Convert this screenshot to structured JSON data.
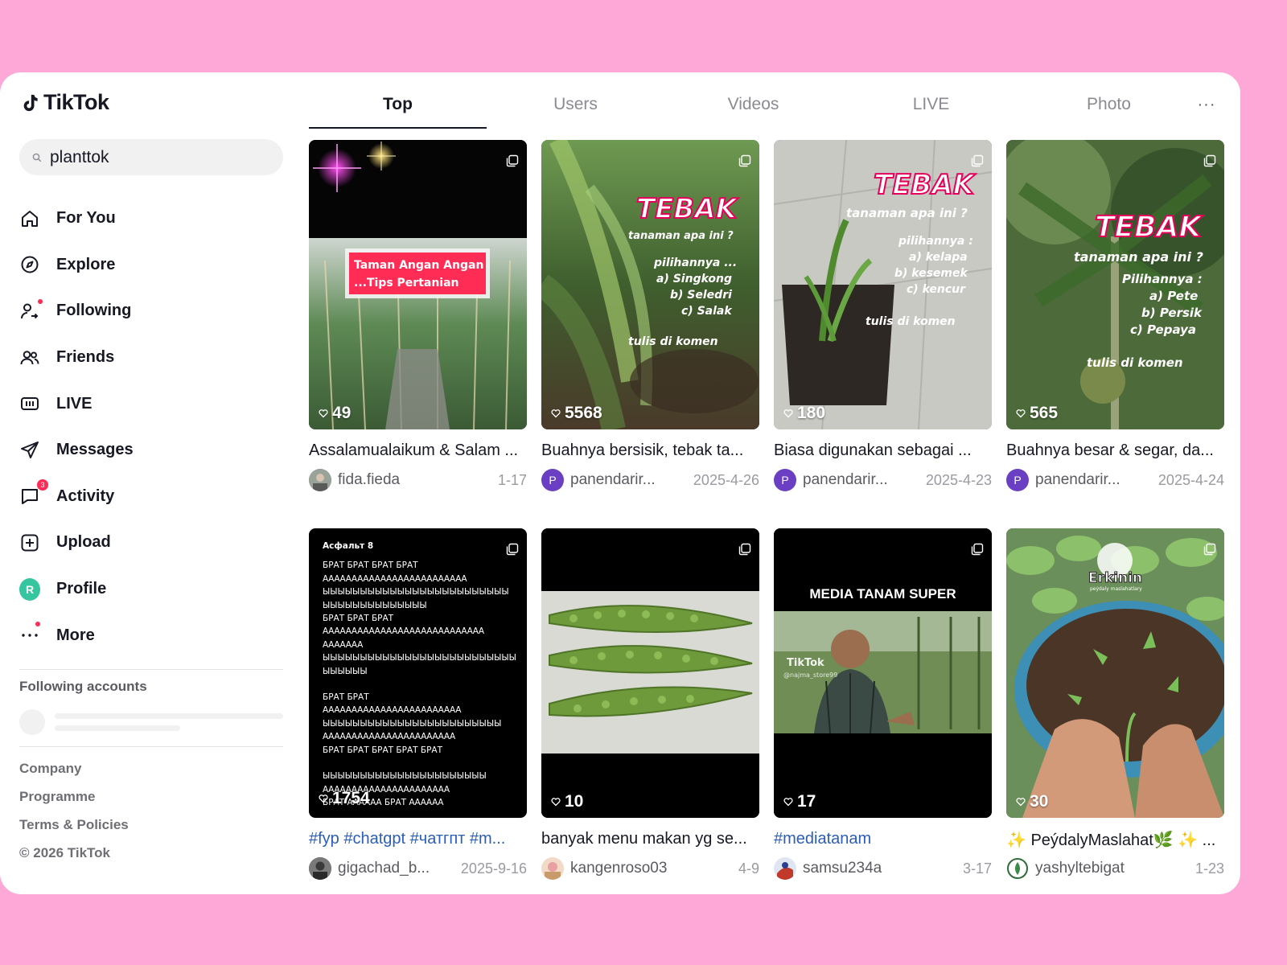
{
  "app": {
    "name": "TikTok"
  },
  "search": {
    "value": "planttok"
  },
  "nav": [
    {
      "label": "For You",
      "icon": "home-icon"
    },
    {
      "label": "Explore",
      "icon": "compass-icon"
    },
    {
      "label": "Following",
      "icon": "following-icon"
    },
    {
      "label": "Friends",
      "icon": "friends-icon"
    },
    {
      "label": "LIVE",
      "icon": "live-icon"
    },
    {
      "label": "Messages",
      "icon": "send-icon"
    },
    {
      "label": "Activity",
      "icon": "chat-icon",
      "badge": "3"
    },
    {
      "label": "Upload",
      "icon": "upload-icon"
    },
    {
      "label": "Profile",
      "avatar": "R"
    },
    {
      "label": "More",
      "icon": "more-icon"
    }
  ],
  "following": {
    "title": "Following accounts"
  },
  "footer": [
    "Company",
    "Programme",
    "Terms & Policies",
    "© 2026 TikTok"
  ],
  "tabs": [
    "Top",
    "Users",
    "Videos",
    "LIVE",
    "Photo"
  ],
  "tab_more": "···",
  "videos": [
    {
      "likes": "49",
      "desc": "Assalamualaikum & Salam ...",
      "user": "fida.fieda",
      "date": "1-17",
      "overlay": [
        "Taman Angan Angan",
        "...Tips Pertanian"
      ]
    },
    {
      "likes": "5568",
      "desc": "Buahnya bersisik, tebak ta...",
      "user": "panendarir...",
      "date": "2025-4-26",
      "avatar": "P",
      "overlay": [
        "TEBAK",
        "tanaman apa ini ?",
        "pilihannya ...",
        "a) Singkong",
        "b) Seledri",
        "c) Salak",
        "tulis di komen"
      ]
    },
    {
      "likes": "180",
      "desc": "Biasa digunakan sebagai ...",
      "user": "panendarir...",
      "date": "2025-4-23",
      "avatar": "P",
      "overlay": [
        "TEBAK",
        "tanaman apa ini ?",
        "pilihannya :",
        "a) kelapa",
        "b) kesemek",
        "c) kencur",
        "tulis di komen"
      ]
    },
    {
      "likes": "565",
      "desc": "Buahnya besar & segar, da...",
      "user": "panendarir...",
      "date": "2025-4-24",
      "avatar": "P",
      "overlay": [
        "TEBAK",
        "tanaman apa ini ?",
        "Pilihannya :",
        "a) Pete",
        "b) Persik",
        "c) Pepaya",
        "tulis di komen"
      ]
    },
    {
      "likes": "1754",
      "desc": "#fyp #chatgpt #чатгпт #m...",
      "user": "gigachad_b...",
      "date": "2025-9-16",
      "tag": true,
      "overlay": [
        "Асфальт 8",
        "БРАТ БРАТ БРАТ БРАТ",
        "ААААААААААААААААААААААААА",
        "ЫЫЫЫЫЫЫЫЫЫЫЫЫЫЫЫЫЫЫЫЫЫЫЫЫ",
        "ЫЫЫЫЫЫЫЫЫЫЫЫЫЫ",
        "БРАТ БРАТ БРАТ",
        "АААААААААААААААААААААААААААА",
        "ААААААА",
        "ЫЫЫЫЫЫЫЫЫЫЫЫЫЫЫЫЫЫЫЫЫЫЫЫЫЫ",
        "ЫЫЫЫЫЫ",
        "БРАТ БРАТ",
        "АААААААААААААААААААААААА",
        "ЫЫЫЫЫЫЫЫЫЫЫЫЫЫЫЫЫЫЫЫЫЫЫЫ",
        "ААААААААААААААААААААААА",
        "БРАТ БРАТ БРАТ БРАТ БРАТ",
        "ЫЫЫЫЫЫЫЫЫЫЫЫЫЫЫЫЫЫЫЫЫЫ",
        "АААААААААААААААААААААА",
        "БРАТ АААААА БРАТ АААААА"
      ]
    },
    {
      "likes": "10",
      "desc": "banyak menu makan yg se...",
      "user": "kangenroso03",
      "date": "4-9"
    },
    {
      "likes": "17",
      "desc": "#mediatanam",
      "user": "samsu234a",
      "date": "3-17",
      "tag": true,
      "overlay": [
        "MEDIA TANAM SUPER",
        "TikTok",
        "@najma_store99"
      ]
    },
    {
      "likes": "30",
      "desc": "✨ PeýdalyMaslahat🌿 ✨ ...",
      "user": "yashyltebigat",
      "date": "1-23",
      "overlay": [
        "Erkinin",
        "peýdaly maslahatlary"
      ]
    }
  ],
  "colors": {
    "accent": "#fe2c55",
    "background": "#fda8d6",
    "avatar_purple": "#6b3fc4",
    "profile_avatar": "#35c6a0",
    "tag_link": "#2b5db9"
  }
}
